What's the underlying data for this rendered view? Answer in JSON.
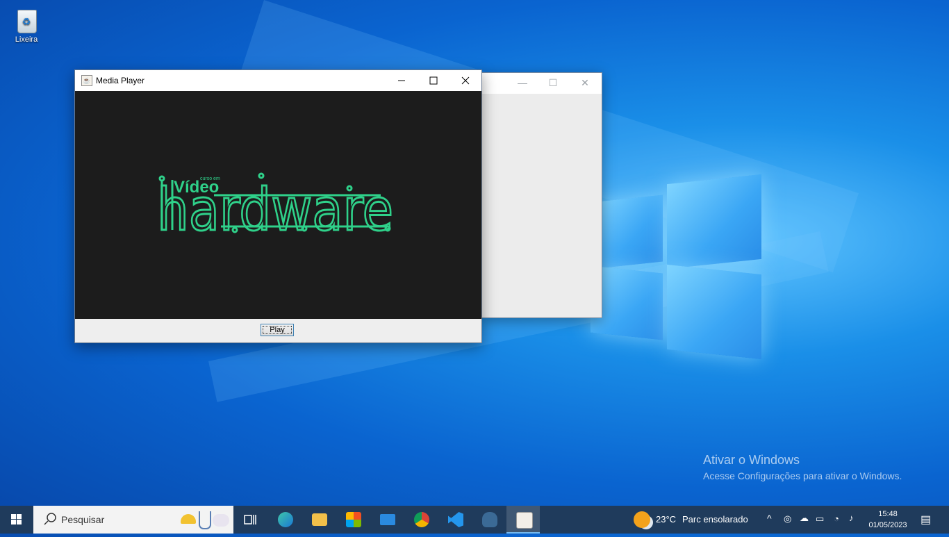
{
  "desktop": {
    "recycle_bin_label": "Lixeira",
    "watermark_title": "Ativar o Windows",
    "watermark_subtitle": "Acesse Configurações para ativar o Windows."
  },
  "window": {
    "title": "Media Player",
    "video_logo_small": "Vídeo",
    "video_logo_tiny": "curso em",
    "video_logo_main": "hardware",
    "play_button_label": "Play"
  },
  "taskbar": {
    "search_placeholder": "Pesquisar",
    "weather_temp": "23°C",
    "weather_desc": "Parc ensolarado",
    "time": "15:48",
    "date": "01/05/2023",
    "apps": [
      "task-view",
      "edge",
      "file-explorer",
      "microsoft-store",
      "mail",
      "chrome",
      "vscode",
      "postgresql",
      "java"
    ]
  },
  "colors": {
    "logo_green": "#2fd18a",
    "video_bg": "#1c1c1c",
    "taskbar_bg": "#1f3b5c"
  }
}
